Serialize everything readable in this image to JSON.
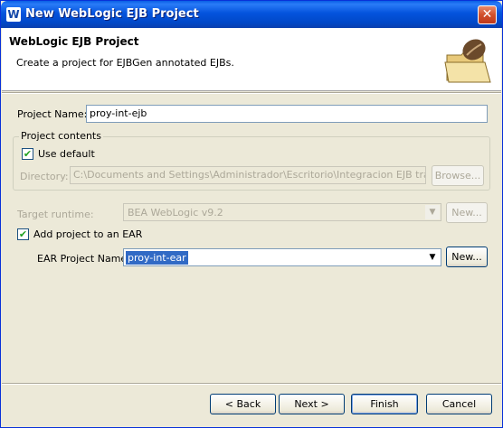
{
  "window": {
    "title": "New WebLogic EJB Project",
    "app_icon": "W",
    "close_glyph": "✕"
  },
  "header": {
    "title": "WebLogic EJB Project",
    "description": "Create a project for EJBGen annotated EJBs.",
    "icon": "folder-with-coffee-bean-icon"
  },
  "form": {
    "project_name_label": "Project Name:",
    "project_name_value": "proy-int-ejb",
    "contents_group_label": "Project contents",
    "use_default_label": "Use default",
    "use_default_checked": true,
    "directory_label": "Directory:",
    "directory_value": "C:\\Documents and Settings\\Administrador\\Escritorio\\Integracion EJB trabajo\\prc",
    "browse_label": "Browse...",
    "target_runtime_label": "Target runtime:",
    "target_runtime_value": "BEA WebLogic v9.2",
    "target_new_label": "New...",
    "add_ear_label": "Add project to an EAR",
    "add_ear_checked": true,
    "ear_name_label": "EAR Project Name:",
    "ear_name_value": "proy-int-ear",
    "ear_new_label": "New..."
  },
  "footer": {
    "back_label": "< Back",
    "next_label": "Next >",
    "finish_label": "Finish",
    "cancel_label": "Cancel"
  },
  "check_glyph": "✔",
  "dropdown_glyph": "▼"
}
